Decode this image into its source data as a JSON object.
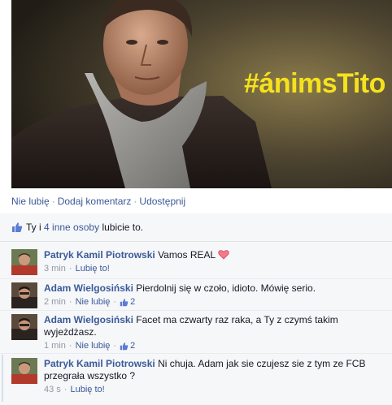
{
  "post": {
    "hashtag": "#ánimsTito"
  },
  "actions": {
    "unlike": "Nie lubię",
    "comment": "Dodaj komentarz",
    "share": "Udostępnij",
    "separator": "·"
  },
  "likes": {
    "you": "Ty",
    "and": "i",
    "others": "4 inne osoby",
    "suffix": "lubicie to."
  },
  "comments": [
    {
      "author": "Patryk Kamil Piotrowski",
      "text": "Vamos REAL",
      "time": "3 min",
      "action": "Lubię to!",
      "like_count": "",
      "has_heart": true,
      "highlight": false
    },
    {
      "author": "Adam Wielgosiński",
      "text": "Pierdolnij się w czoło, idioto. Mówię serio.",
      "time": "2 min",
      "action": "Nie lubię",
      "like_count": "2",
      "has_heart": false,
      "highlight": false
    },
    {
      "author": "Adam Wielgosiński",
      "text": "Facet ma czwarty raz raka, a Ty z czymś takim wyjeżdżasz.",
      "time": "1 min",
      "action": "Nie lubię",
      "like_count": "2",
      "has_heart": false,
      "highlight": false
    },
    {
      "author": "Patryk Kamil Piotrowski",
      "text": "Ni chuja. Adam jak sie czujesz sie z tym ze FCB przegrała wszystko ?",
      "time": "43 s",
      "action": "Lubię to!",
      "like_count": "",
      "has_heart": false,
      "highlight": true
    }
  ],
  "colors": {
    "link": "#3b5998",
    "meta": "#9197a3",
    "feedback_bg": "#f6f7f9",
    "hashtag": "#f5e21c"
  }
}
